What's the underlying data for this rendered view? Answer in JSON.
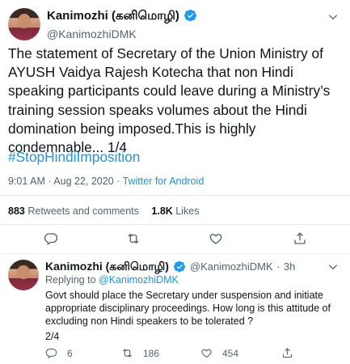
{
  "main_tweet": {
    "author_name": "Kanimozhi (கனிமொழி)",
    "author_handle": "@KanimozhiDMK",
    "body": "The statement of Secretary of the Union Ministry of AYUSH Vaidya Rajesh Kotecha that non Hindi speaking participants could leave during a Ministry’s training session speaks volumes about the Hindi domination being imposed.This is highly condemnable...  1/4",
    "hashtag": "#StopHindiImposition",
    "timestamp": "9:01 AM · Aug 22, 2020",
    "separator": " · ",
    "source": "Twitter for Android",
    "retweets_count": "883",
    "retweets_label": "Retweets and comments",
    "likes_count": "1.8K",
    "likes_label": "Likes"
  },
  "reply_tweet": {
    "author_name": "Kanimozhi (கனிமொழி)",
    "author_handle": "@KanimozhiDMK",
    "dot": "·",
    "age": "3h",
    "replying_prefix": "Replying to ",
    "replying_handle": "@KanimozhiDMK",
    "body": "Govt should place the Secretary under suspension and initiate appropriate disciplinary proceedings. How long is this attitude of excluding non Hindi speakers to be tolerated ?",
    "thread_index": "2/4",
    "reply_count": "6",
    "retweet_count": "186",
    "like_count": "454"
  },
  "colors": {
    "accent": "#1b95e0",
    "text": "#0f1419",
    "muted": "#536471",
    "divider": "#e6ecf0",
    "verified": "#1d9bf0"
  },
  "icons": [
    "verified-badge-icon",
    "chevron-down-icon",
    "reply-icon",
    "retweet-icon",
    "like-icon",
    "share-icon"
  ]
}
